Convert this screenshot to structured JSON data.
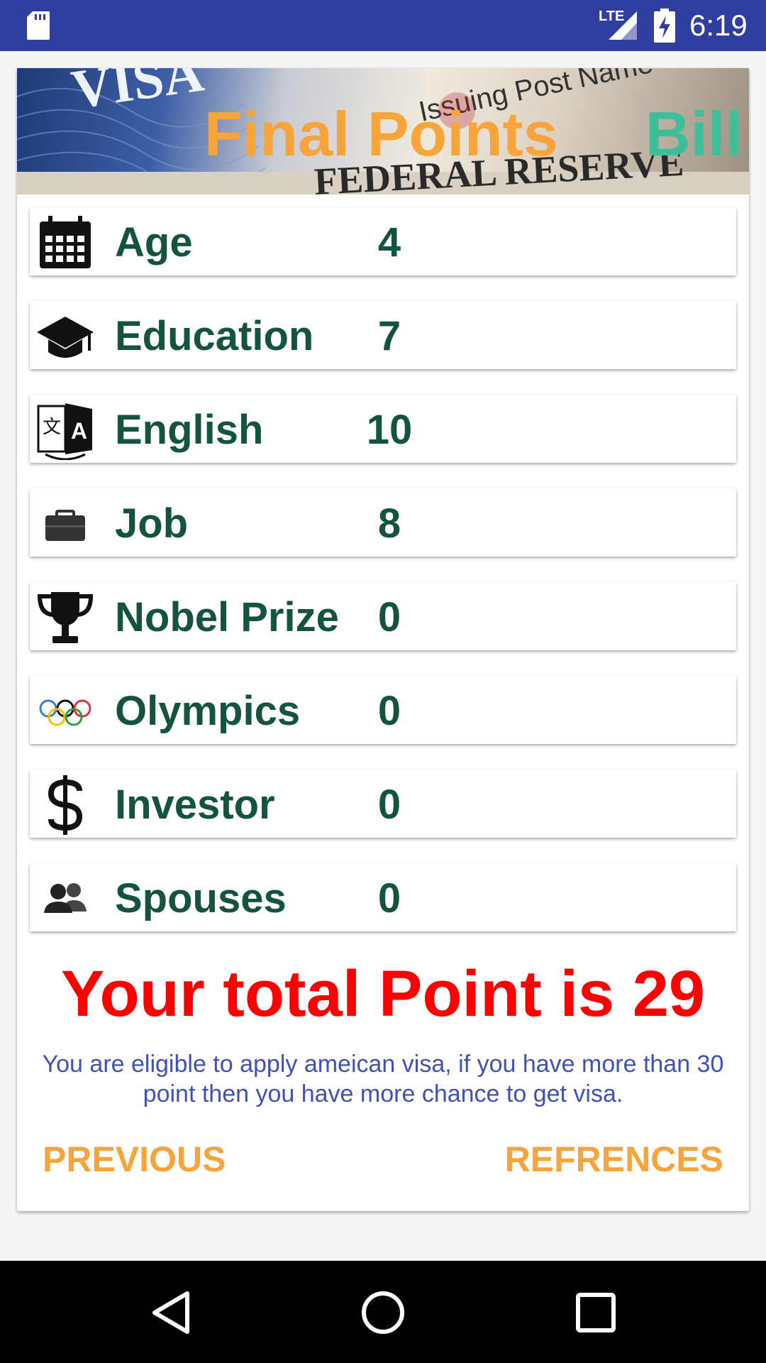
{
  "status_bar": {
    "network": "LTE",
    "time": "6:19",
    "icons": [
      "sd-card-icon",
      "signal-icon",
      "battery-charging-icon"
    ]
  },
  "banner": {
    "title": "Final Points",
    "name": "Bill",
    "background_text": [
      "VISA",
      "Issuing Post Name",
      "FEDERAL RESERVE"
    ]
  },
  "rows": [
    {
      "label": "Age",
      "value": "4",
      "icon": "calendar-icon"
    },
    {
      "label": "Education",
      "value": "7",
      "icon": "graduation-cap-icon"
    },
    {
      "label": "English",
      "value": "10",
      "icon": "translate-icon"
    },
    {
      "label": "Job",
      "value": "8",
      "icon": "briefcase-icon"
    },
    {
      "label": "Nobel Prize",
      "value": "0",
      "icon": "trophy-icon"
    },
    {
      "label": "Olympics",
      "value": "0",
      "icon": "olympic-rings-icon"
    },
    {
      "label": "Investor",
      "value": "0",
      "icon": "dollar-icon"
    },
    {
      "label": "Spouses",
      "value": "0",
      "icon": "people-icon"
    }
  ],
  "total_text": "Your total Point is 29",
  "note": "You are eligible to apply ameican visa, if you have more than 30 point then you have more chance to get visa.",
  "buttons": {
    "previous": "PREVIOUS",
    "references": "REFRENCES"
  },
  "colors": {
    "status_bar": "#303f9f",
    "title": "#f7a53a",
    "name": "#3dbf9a",
    "row_text": "#14533f",
    "total": "#ff0000",
    "note": "#3f51b5",
    "button": "#f7a53a"
  }
}
